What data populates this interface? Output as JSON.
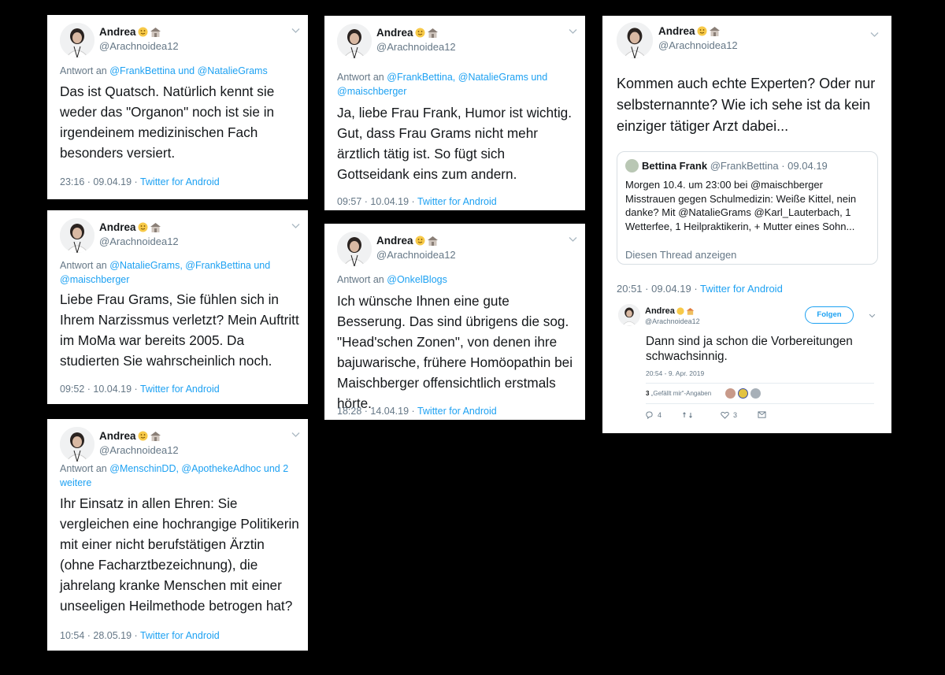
{
  "tweets": {
    "t1": {
      "name": "Andrea",
      "handle": "@Arachnoidea12",
      "reply_prefix": "Antwort an",
      "reply_to": "@FrankBettina und @NatalieGrams",
      "text": "Das ist Quatsch. Natürlich kennt sie weder das \"Organon\" noch ist sie in irgendeinem medizinischen Fach besonders versiert.",
      "time": "23:16 · 09.04.19",
      "source": "Twitter for Android"
    },
    "t2": {
      "name": "Andrea",
      "handle": "@Arachnoidea12",
      "reply_prefix": "Antwort an",
      "reply_to": "@NatalieGrams, @FrankBettina und @maischberger",
      "text": "Liebe Frau Grams, Sie fühlen sich in Ihrem Narzissmus verletzt? Mein Auftritt im MoMa war bereits 2005. Da studierten Sie wahrscheinlich noch.",
      "time": "09:52 · 10.04.19",
      "source": "Twitter for Android"
    },
    "t3": {
      "name": "Andrea",
      "handle": "@Arachnoidea12",
      "reply_prefix": "Antwort an",
      "reply_to": "@MenschinDD, @ApothekeAdhoc und 2 weitere",
      "text": "Ihr Einsatz in allen Ehren: Sie vergleichen eine hochrangige Politikerin mit einer nicht berufstätigen Ärztin (ohne Facharztbezeichnung), die jahrelang kranke Menschen mit einer unseeligen Heilmethode betrogen hat?",
      "time": "10:54 · 28.05.19",
      "source": "Twitter for Android"
    },
    "t4": {
      "name": "Andrea",
      "handle": "@Arachnoidea12",
      "reply_prefix": "Antwort an",
      "reply_to": "@FrankBettina, @NatalieGrams und @maischberger",
      "text": "Ja, liebe Frau Frank, Humor ist wichtig. Gut, dass Frau Grams nicht mehr ärztlich tätig ist. So fügt sich Gottseidank eins zum andern.",
      "time": "09:57 · 10.04.19",
      "source": "Twitter for Android"
    },
    "t5": {
      "name": "Andrea",
      "handle": "@Arachnoidea12",
      "reply_prefix": "Antwort an",
      "reply_to": "@OnkelBlogs",
      "text": "Ich wünsche Ihnen eine gute Besserung. Das sind übrigens die sog. \"Head'schen Zonen\", von denen ihre bajuwarische, frühere Homöopathin bei Maischberger offensichtlich erstmals hörte.",
      "time": "18:28 · 14.04.19",
      "source": "Twitter for Android"
    },
    "t6": {
      "name": "Andrea",
      "handle": "@Arachnoidea12",
      "text": "Kommen auch echte Experten? Oder nur selbsternannte? Wie ich sehe ist da kein einziger tätiger Arzt dabei...",
      "time": "20:51 · 09.04.19",
      "source": "Twitter for Android",
      "quote": {
        "name": "Bettina Frank",
        "handle": "@FrankBettina",
        "date": "· 09.04.19",
        "body": "Morgen 10.4. um 23:00 bei @maischberger Misstrauen gegen Schulmedizin: Weiße Kittel, nein danke? Mit @NatalieGrams @Karl_Lauterbach, 1 Wetterfee, 1 Heilpraktikerin, + Mutter eines Sohn...",
        "show_thread": "Diesen Thread anzeigen"
      },
      "embed": {
        "name": "Andrea",
        "handle": "@Arachnoidea12",
        "follow": "Folgen",
        "text": "Dann sind ja schon die Vorbereitungen schwachsinnig.",
        "time": "20:54 - 9. Apr. 2019",
        "likes_count": "3",
        "likes_label": "„Gefällt mir“-Angaben",
        "replies": "4",
        "retweets": "",
        "likes": "3"
      }
    }
  },
  "colors": {
    "link": "#1da1f2",
    "muted": "#657786",
    "text": "#14171a",
    "background": "#000000"
  },
  "icons": [
    "avatar-photo",
    "smiley-icon",
    "house-icon",
    "chevron-down-icon",
    "reply-icon",
    "retweet-icon",
    "heart-icon",
    "message-icon"
  ]
}
